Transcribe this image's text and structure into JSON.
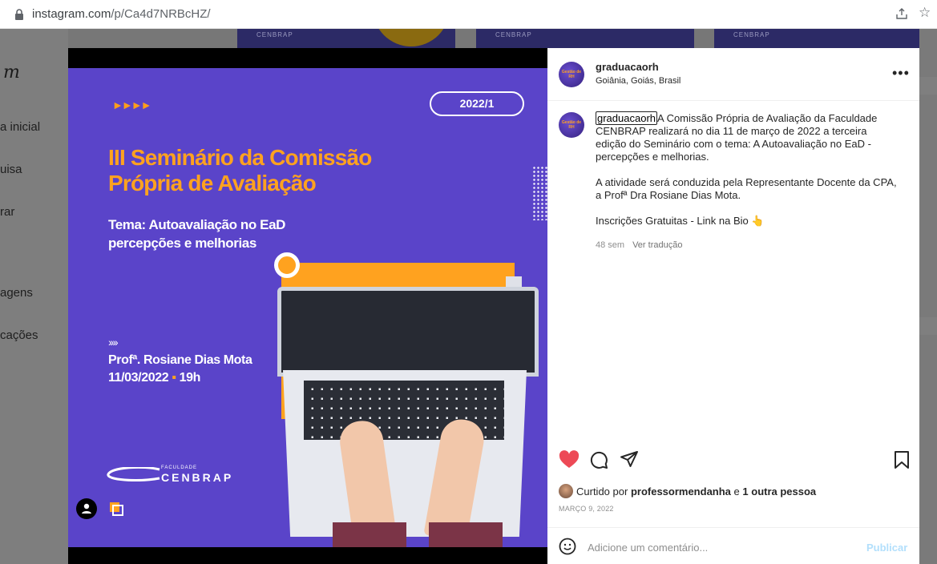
{
  "browser": {
    "url_host": "instagram.com",
    "url_path": "/p/Ca4d7NRBcHZ/"
  },
  "background_page": {
    "logo": "m",
    "nav_items": [
      "a inicial",
      "uisa",
      "rar",
      "agens",
      "cações"
    ],
    "tile_brand": "CENBRAP"
  },
  "post": {
    "image": {
      "year_pill": "2022/1",
      "title_line1": "III Seminário da Comissão",
      "title_line2": "Própria de Avaliação",
      "theme_line1": "Tema: Autoavaliação no EaD",
      "theme_line2": "percepções e melhorias",
      "speaker": "Profª. Rosiane Dias Mota",
      "date": "11/03/2022",
      "time": "19h",
      "brand_small": "FACULDADE",
      "brand_big": "CENBRAP"
    },
    "author": {
      "username": "graduacaorh",
      "location": "Goiânia, Goiás, Brasil",
      "avatar_text": "Gestão de RH"
    },
    "caption": {
      "username": "graduacaorh",
      "p1": "A Comissão Própria de Avaliação da Faculdade CENBRAP realizará no dia 11 de março de 2022 a terceira edição do Seminário com o tema: A Autoavaliação no EaD - percepções e melhorias.",
      "p2": "A atividade será conduzida pela Representante Docente da CPA, a Profª Dra Rosiane Dias Mota.",
      "p3": "Inscrições Gratuitas - Link na Bio 👆"
    },
    "meta": {
      "age": "48 sem",
      "translate": "Ver tradução"
    },
    "likes": {
      "prefix": "Curtido por",
      "user": "professormendanha",
      "conj": "e",
      "others": "1 outra pessoa"
    },
    "posted_date": "MARÇO 9, 2022",
    "comment": {
      "placeholder": "Adicione um comentário...",
      "publish": "Publicar"
    },
    "liked": true
  },
  "colors": {
    "poster_bg": "#5a44c9",
    "poster_accent": "#ffa21f",
    "heart": "#ed4956",
    "publish_disabled": "#b2dffc"
  }
}
